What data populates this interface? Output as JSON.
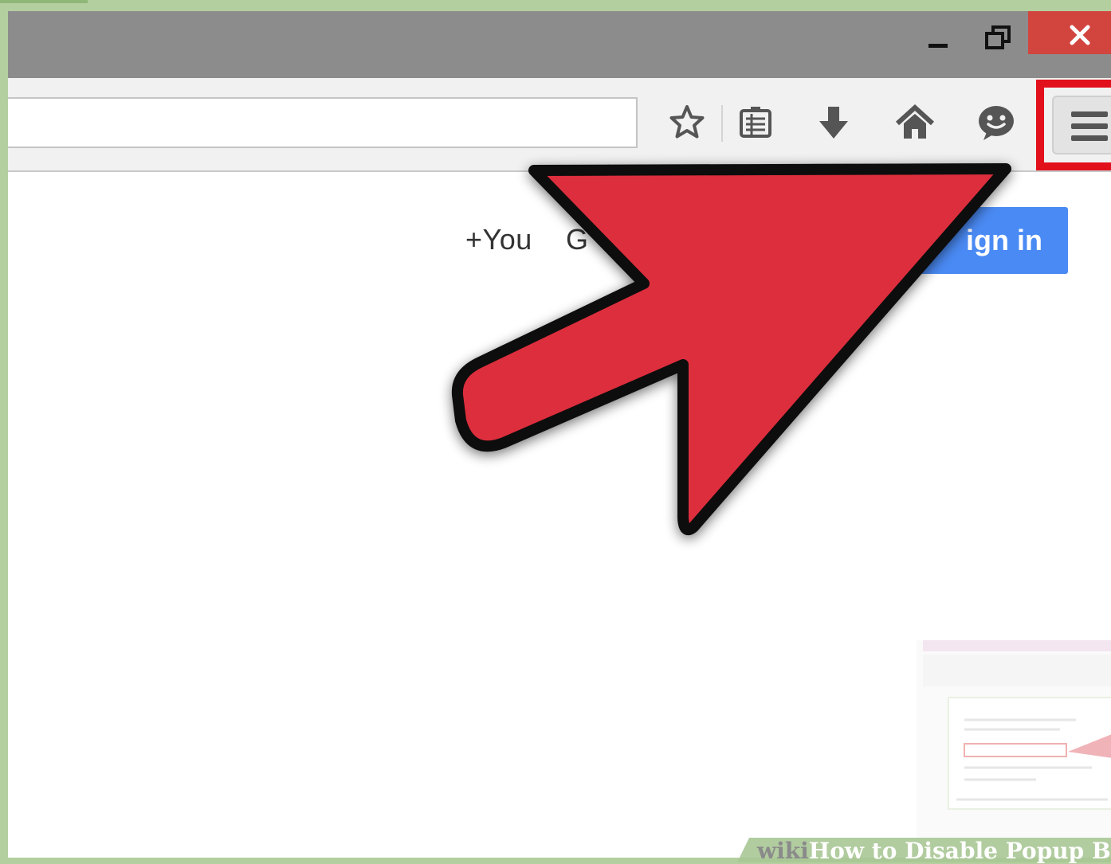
{
  "window": {
    "minimize_label": "",
    "maximize_label": "",
    "close_label": "✕"
  },
  "toolbar": {
    "url_value": "",
    "icons": [
      "star-icon",
      "reading-list-icon",
      "download-icon",
      "home-icon",
      "chat-icon"
    ],
    "menu_icon": "hamburger-menu-icon"
  },
  "page": {
    "plus_you": "+You",
    "gmail_partial": "G",
    "signin_label": "ign in"
  },
  "watermark": {
    "wiki": "wiki",
    "title": "How to Disable Popup Block"
  },
  "colors": {
    "arrow_fill": "#dd2f3e",
    "highlight": "#e2101b",
    "signin": "#4a8af4",
    "close": "#d2453f"
  }
}
